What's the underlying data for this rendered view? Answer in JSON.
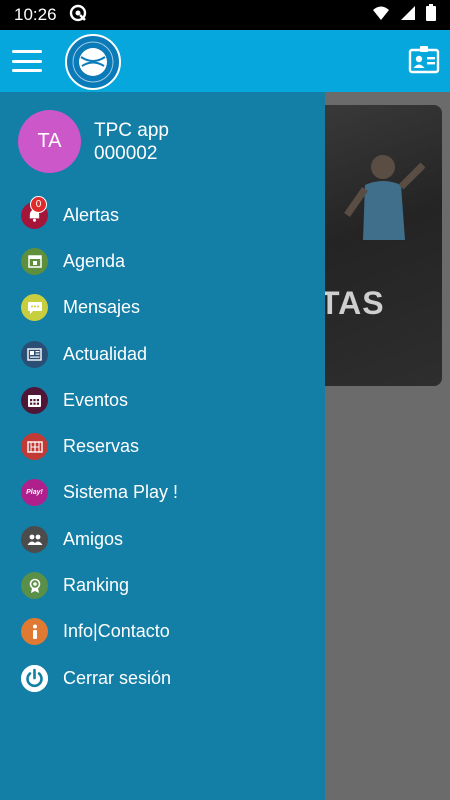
{
  "status_bar": {
    "time": "10:26"
  },
  "profile": {
    "initials": "TA",
    "name": "TPC app",
    "id": "000002"
  },
  "alerts_badge": "0",
  "menu": [
    {
      "label": "Alertas",
      "icon": "bell-icon",
      "color": "#a5153a"
    },
    {
      "label": "Agenda",
      "icon": "calendar-icon",
      "color": "#5e8f3c"
    },
    {
      "label": "Mensajes",
      "icon": "chat-bubble-icon",
      "color": "#c8cf3e"
    },
    {
      "label": "Actualidad",
      "icon": "newspaper-icon",
      "color": "#2b4f74"
    },
    {
      "label": "Eventos",
      "icon": "calendar-grid-icon",
      "color": "#4f1737"
    },
    {
      "label": "Reservas",
      "icon": "court-icon",
      "color": "#c23a35"
    },
    {
      "label": "Sistema Play !",
      "icon": "play-icon",
      "color": "#b0208c"
    },
    {
      "label": "Amigos",
      "icon": "friends-icon",
      "color": "#4c4c4c"
    },
    {
      "label": "Ranking",
      "icon": "medal-icon",
      "color": "#5a8f47"
    },
    {
      "label": "Info|Contacto",
      "icon": "info-icon",
      "color": "#e07a32"
    },
    {
      "label": "Cerrar sesión",
      "icon": "power-icon",
      "color": "#ffffff"
    }
  ],
  "background_card": {
    "text": "TAS"
  },
  "colors": {
    "app_bar": "#05a7dc",
    "drawer": "#137ea6",
    "avatar": "#cc57c9"
  }
}
